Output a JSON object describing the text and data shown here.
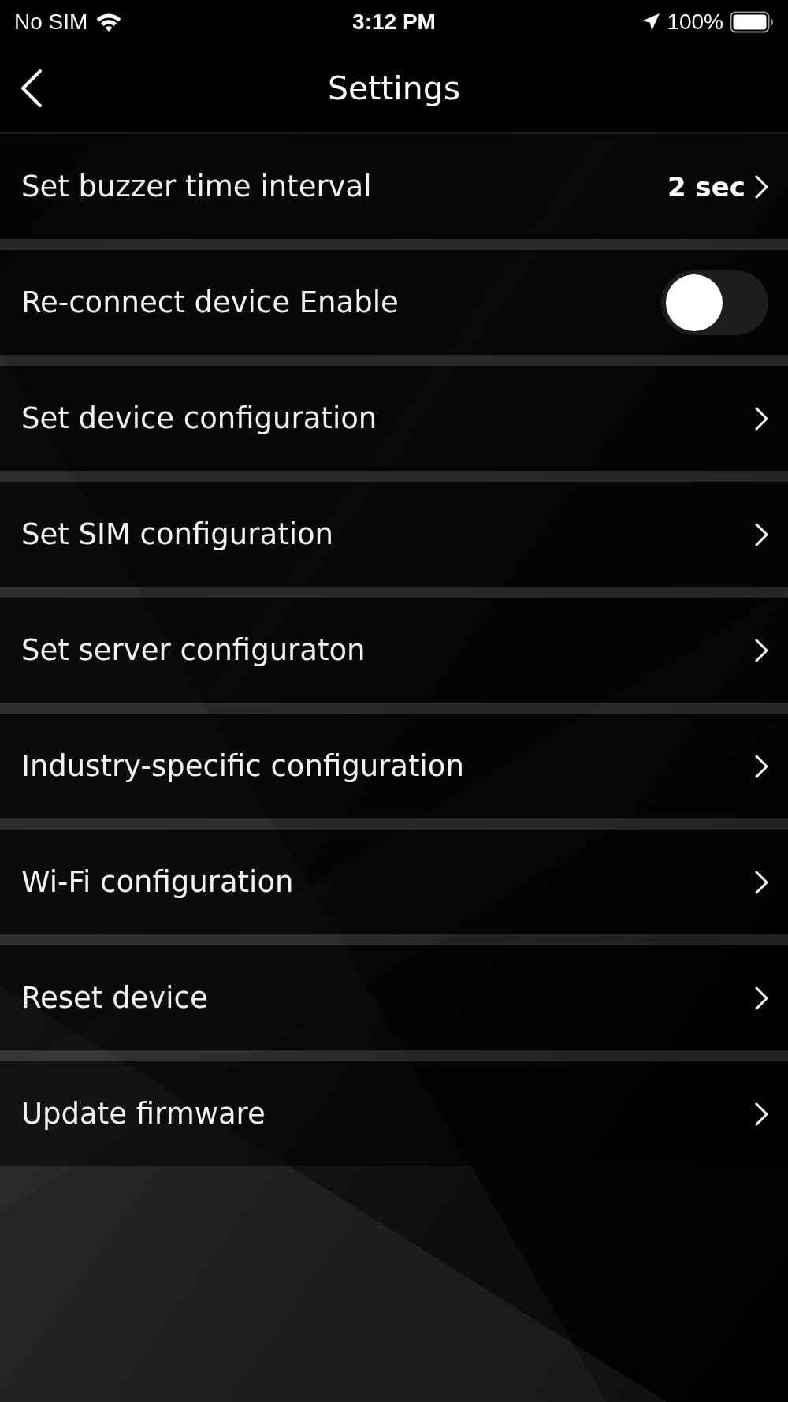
{
  "status_bar": {
    "carrier": "No SIM",
    "time": "3:12 PM",
    "battery": "100%"
  },
  "header": {
    "title": "Settings"
  },
  "settings": [
    {
      "kind": "link",
      "label": "Set buzzer time interval",
      "value": "2 sec"
    },
    {
      "kind": "toggle",
      "label": "Re-connect device Enable",
      "on": false
    },
    {
      "kind": "link",
      "label": "Set device configuration"
    },
    {
      "kind": "link",
      "label": "Set SIM configuration"
    },
    {
      "kind": "link",
      "label": "Set server configuraton"
    },
    {
      "kind": "link",
      "label": "Industry-specific configuration"
    },
    {
      "kind": "link",
      "label": "Wi-Fi configuration"
    },
    {
      "kind": "link",
      "label": "Reset device"
    },
    {
      "kind": "link",
      "label": "Update firmware"
    }
  ]
}
